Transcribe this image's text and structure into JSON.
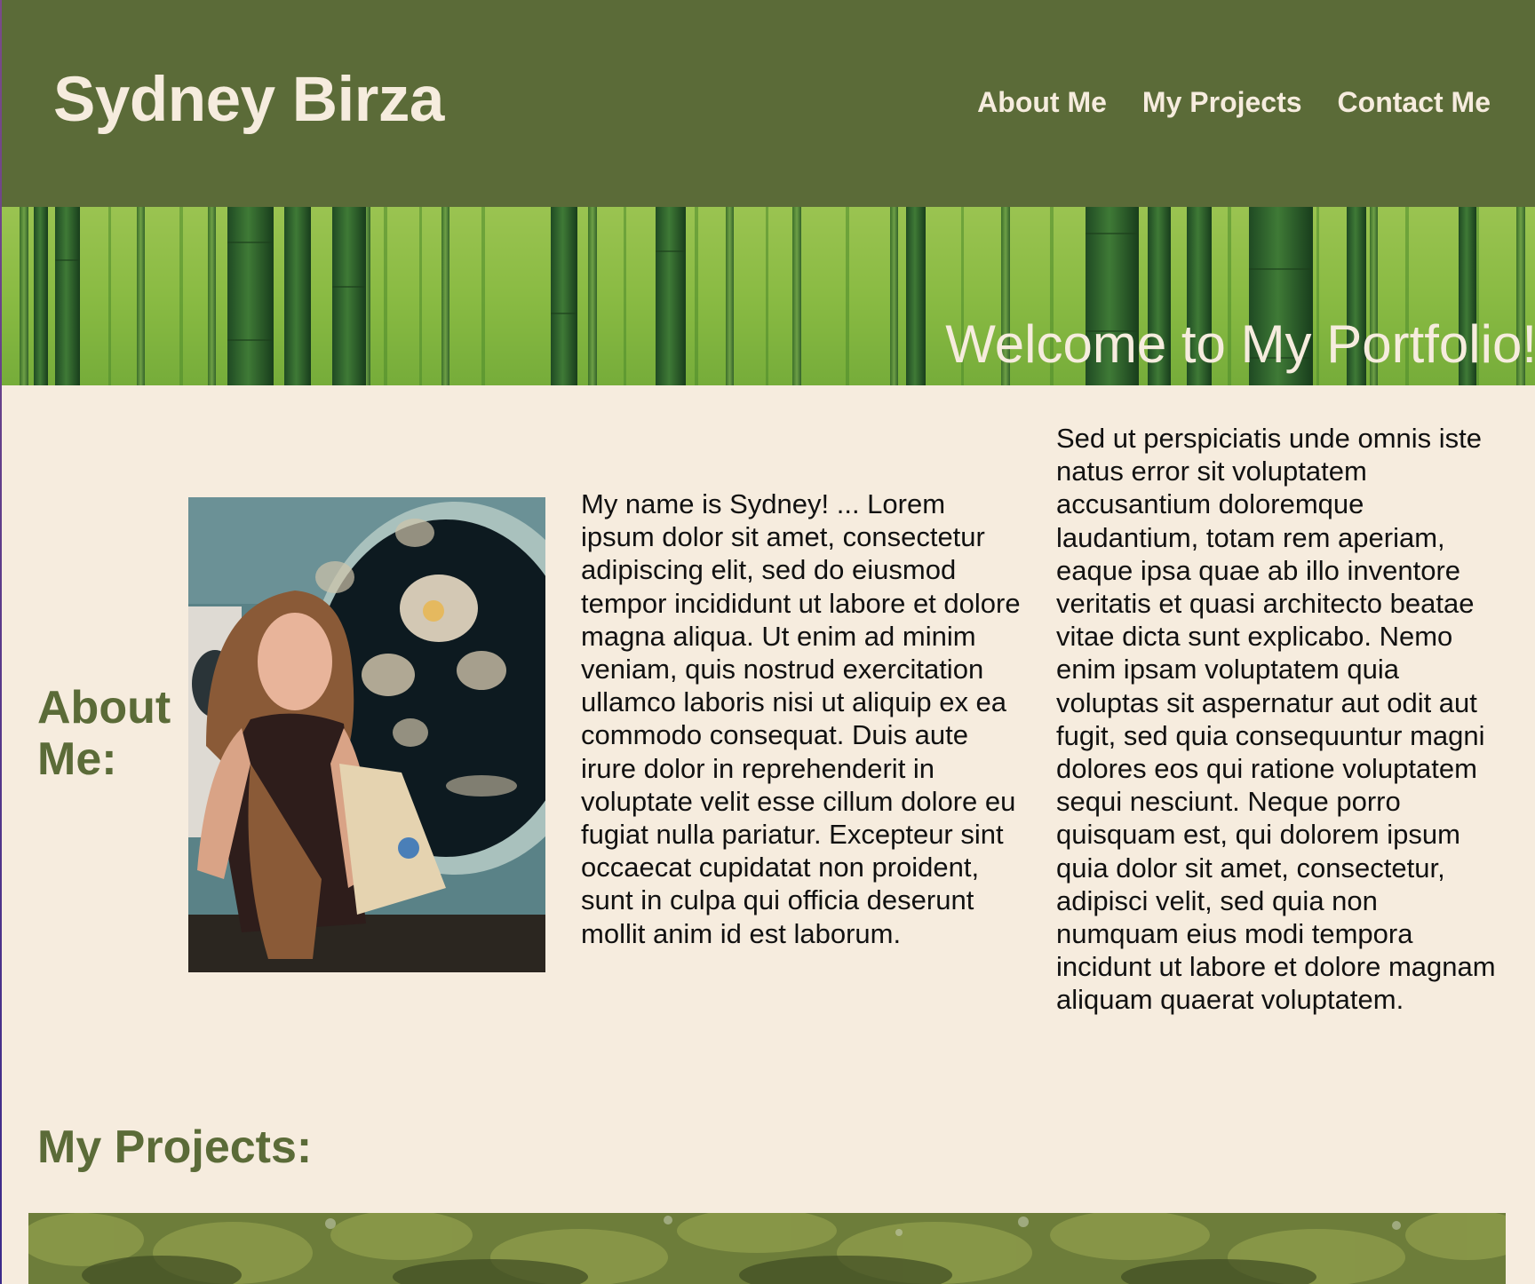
{
  "header": {
    "site_title": "Sydney Birza",
    "nav": [
      {
        "label": "About Me"
      },
      {
        "label": "My Projects"
      },
      {
        "label": "Contact Me"
      }
    ]
  },
  "banner": {
    "welcome_text": "Welcome to My Portfolio!"
  },
  "about": {
    "heading": "About Me:",
    "paragraph_1": "My name is Sydney! ... Lorem ipsum dolor sit amet, consectetur adipiscing elit, sed do eiusmod tempor incididunt ut labore et dolore magna aliqua. Ut enim ad minim veniam, quis nostrud exercitation ullamco laboris nisi ut aliquip ex ea commodo consequat. Duis aute irure dolor in reprehenderit in voluptate velit esse cillum dolore eu fugiat nulla pariatur. Excepteur sint occaecat cupidatat non proident, sunt in culpa qui officia deserunt mollit anim id est laborum.",
    "paragraph_2": "Sed ut perspiciatis unde omnis iste natus error sit voluptatem accusantium doloremque laudantium, totam rem aperiam, eaque ipsa quae ab illo inventore veritatis et quasi architecto beatae vitae dicta sunt explicabo. Nemo enim ipsam voluptatem quia voluptas sit aspernatur aut odit aut fugit, sed quia consequuntur magni dolores eos qui ratione voluptatem sequi nesciunt. Neque porro quisquam est, qui dolorem ipsum quia dolor sit amet, consectetur, adipisci velit, sed quia non numquam eius modi tempora incidunt ut labore et dolore magnam aliquam quaerat voluptatem."
  },
  "projects": {
    "heading": "My Projects:"
  },
  "colors": {
    "header_bg": "#5b6b38",
    "page_bg": "#f6ecde",
    "accent_text": "#5b6b38",
    "light_text": "#f6ecde"
  }
}
